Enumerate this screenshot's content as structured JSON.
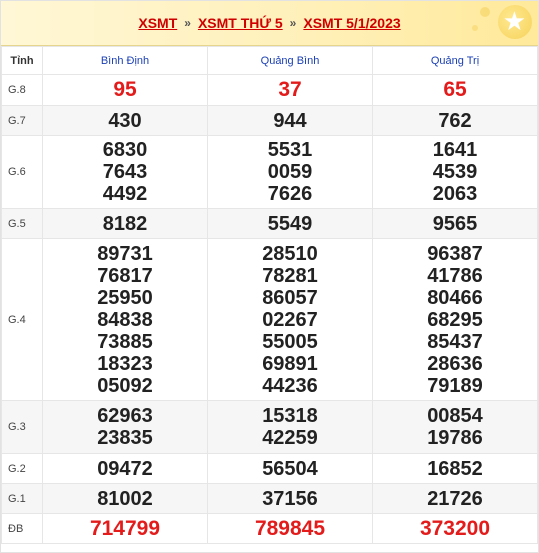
{
  "breadcrumb": {
    "link1": "XSMT",
    "link2": "XSMT THỨ 5",
    "link3": "XSMT 5/1/2023",
    "separator": "»"
  },
  "table": {
    "label_header": "Tỉnh",
    "provinces": [
      "Bình Định",
      "Quảng Bình",
      "Quảng Trị"
    ],
    "rows": [
      {
        "label": "G.8",
        "values": [
          [
            "95"
          ],
          [
            "37"
          ],
          [
            "65"
          ]
        ]
      },
      {
        "label": "G.7",
        "values": [
          [
            "430"
          ],
          [
            "944"
          ],
          [
            "762"
          ]
        ]
      },
      {
        "label": "G.6",
        "values": [
          [
            "6830",
            "7643",
            "4492"
          ],
          [
            "5531",
            "0059",
            "7626"
          ],
          [
            "1641",
            "4539",
            "2063"
          ]
        ]
      },
      {
        "label": "G.5",
        "values": [
          [
            "8182"
          ],
          [
            "5549"
          ],
          [
            "9565"
          ]
        ]
      },
      {
        "label": "G.4",
        "values": [
          [
            "89731",
            "76817",
            "25950",
            "84838",
            "73885",
            "18323",
            "05092"
          ],
          [
            "28510",
            "78281",
            "86057",
            "02267",
            "55005",
            "69891",
            "44236"
          ],
          [
            "96387",
            "41786",
            "80466",
            "68295",
            "85437",
            "28636",
            "79189"
          ]
        ]
      },
      {
        "label": "G.3",
        "values": [
          [
            "62963",
            "23835"
          ],
          [
            "15318",
            "42259"
          ],
          [
            "00854",
            "19786"
          ]
        ]
      },
      {
        "label": "G.2",
        "values": [
          [
            "09472"
          ],
          [
            "56504"
          ],
          [
            "16852"
          ]
        ]
      },
      {
        "label": "G.1",
        "values": [
          [
            "81002"
          ],
          [
            "37156"
          ],
          [
            "21726"
          ]
        ]
      },
      {
        "label": "ĐB",
        "values": [
          [
            "714799"
          ],
          [
            "789845"
          ],
          [
            "373200"
          ]
        ]
      }
    ]
  },
  "colors": {
    "link": "#d00000",
    "province": "#1a3fb5",
    "highlight": "#e31b1b"
  }
}
